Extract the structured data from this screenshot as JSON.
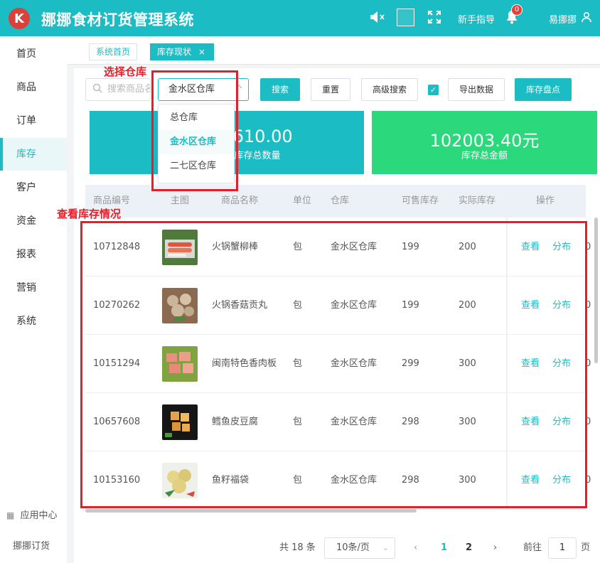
{
  "header": {
    "logo_text": "K",
    "title": "挪挪食材订货管理系统",
    "guide_label": "新手指导",
    "notification_count": "0",
    "user_name": "易挪挪",
    "bg_color": "#1bbcc4"
  },
  "sidebar": {
    "items": [
      {
        "label": "首页"
      },
      {
        "label": "商品"
      },
      {
        "label": "订单"
      },
      {
        "label": "库存",
        "active": true
      },
      {
        "label": "客户"
      },
      {
        "label": "资金"
      },
      {
        "label": "报表"
      },
      {
        "label": "营销"
      },
      {
        "label": "系统"
      }
    ],
    "app_center": "应用中心",
    "brand": "挪挪订货"
  },
  "tabs": [
    {
      "label": "系统首页"
    },
    {
      "label": "库存现状",
      "close": "×"
    }
  ],
  "toolbar": {
    "search_placeholder": "搜索商品名",
    "warehouse_selected": "金水区仓库",
    "search_button": "搜索",
    "reset_button": "重置",
    "advanced_search": "高级搜索",
    "checkbox_checked": true,
    "export_button": "导出数据",
    "inventory_check_button": "库存盘点"
  },
  "warehouse_dropdown": {
    "options": [
      "总仓库",
      "金水区仓库",
      "二七区仓库"
    ],
    "selected": "金水区仓库"
  },
  "stats": [
    {
      "value": "7610.00",
      "label": "库存总数量",
      "color": "#1bbcc4"
    },
    {
      "value": "102003.40元",
      "label": "库存总金额",
      "color": "#2bd87b"
    }
  ],
  "table": {
    "headers": [
      "商品编号",
      "主图",
      "商品名称",
      "单位",
      "仓库",
      "可售库存",
      "实际库存",
      "操作"
    ],
    "rows": [
      {
        "code": "10712848",
        "name": "火锅蟹柳棒",
        "unit": "包",
        "warehouse": "金水区仓库",
        "available": "199",
        "actual": "200",
        "view": "查看",
        "dist": "分布",
        "cut": "0",
        "img": "crab"
      },
      {
        "code": "10270262",
        "name": "火锅香菇贡丸",
        "unit": "包",
        "warehouse": "金水区仓库",
        "available": "199",
        "actual": "200",
        "view": "查看",
        "dist": "分布",
        "cut": "0",
        "img": "meatball"
      },
      {
        "code": "10151294",
        "name": "闽南特色香肉板",
        "unit": "包",
        "warehouse": "金水区仓库",
        "available": "299",
        "actual": "300",
        "view": "查看",
        "dist": "分布",
        "cut": "0",
        "img": "meat"
      },
      {
        "code": "10657608",
        "name": "鳕鱼皮豆腐",
        "unit": "包",
        "warehouse": "金水区仓库",
        "available": "298",
        "actual": "300",
        "view": "查看",
        "dist": "分布",
        "cut": "0",
        "img": "tofu"
      },
      {
        "code": "10153160",
        "name": "鱼籽福袋",
        "unit": "包",
        "warehouse": "金水区仓库",
        "available": "298",
        "actual": "300",
        "view": "查看",
        "dist": "分布",
        "cut": "0",
        "img": "bag"
      }
    ]
  },
  "annotations": {
    "select_warehouse": "选择仓库",
    "view_inventory": "查看库存情况",
    "color": "#e0212b"
  },
  "pagination": {
    "total": "共 18 条",
    "page_size": "10条/页",
    "prev": "‹",
    "pages": [
      "1",
      "2"
    ],
    "current": "1",
    "next": "›",
    "goto_prefix": "前往",
    "goto_value": "1",
    "goto_suffix": "页"
  }
}
